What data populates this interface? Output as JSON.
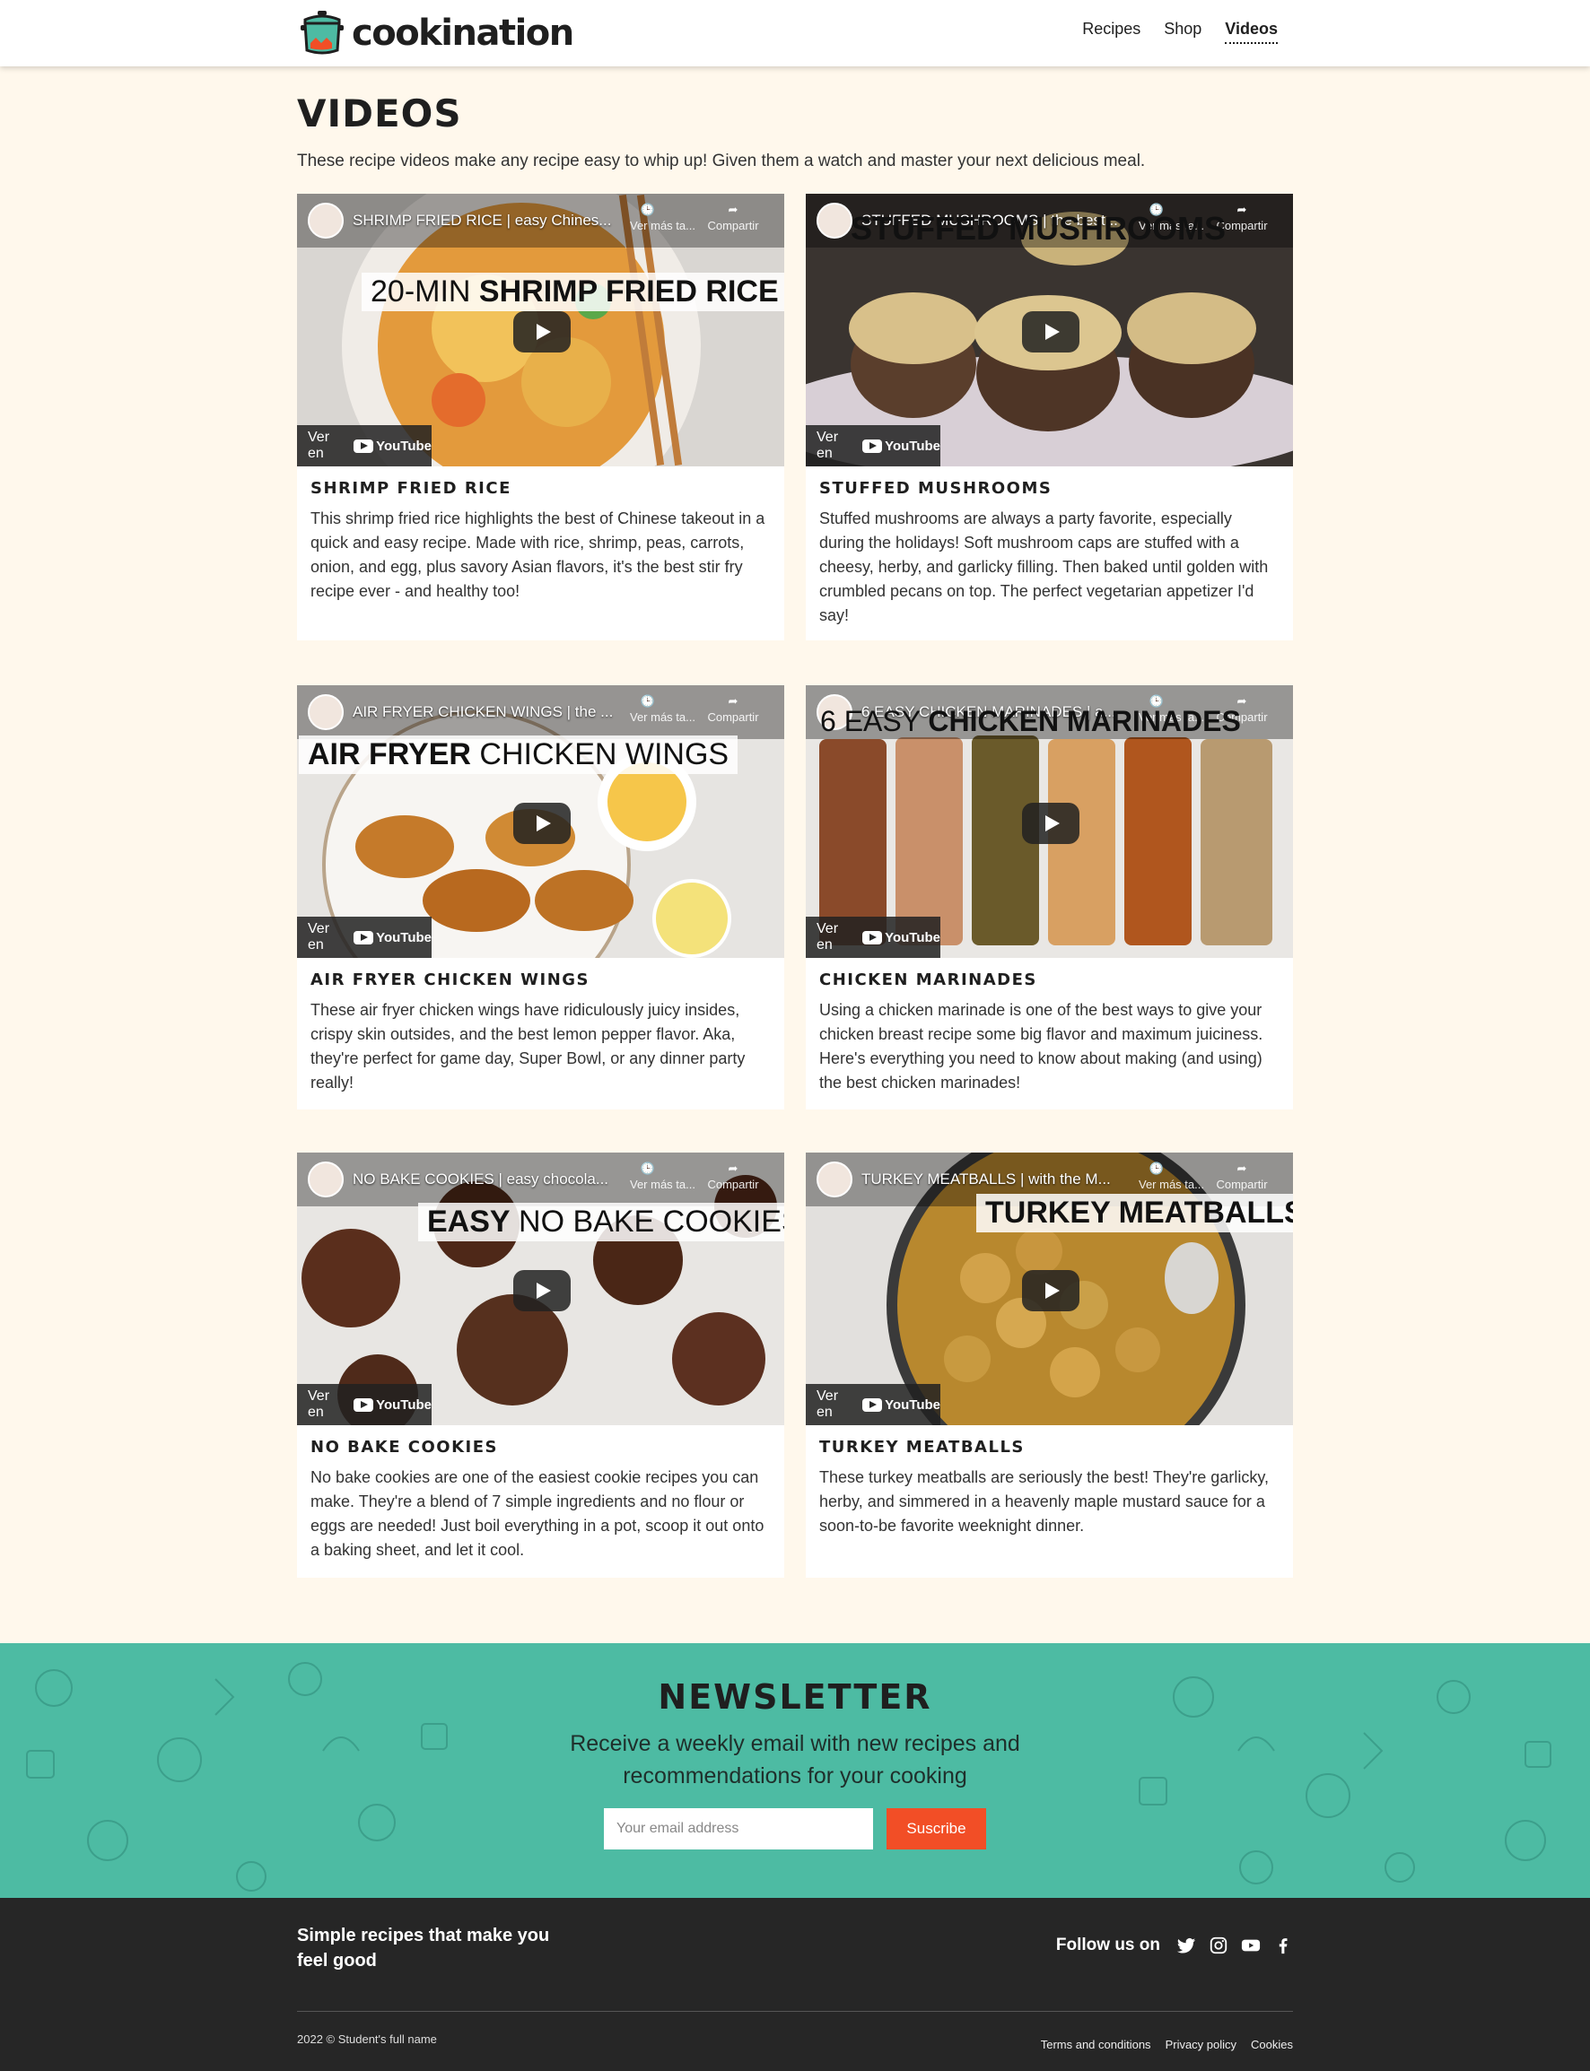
{
  "header": {
    "logo_text": "cookination",
    "nav": [
      {
        "label": "Recipes",
        "active": false
      },
      {
        "label": "Shop",
        "active": false
      },
      {
        "label": "Videos",
        "active": true
      }
    ]
  },
  "main": {
    "title": "VIDEOS",
    "intro": "These recipe videos make any recipe easy to whip up! Given them a watch and master your next delicious meal.",
    "youtube": {
      "watch_later": "Ver más ta...",
      "share": "Compartir",
      "watch_on": "Ver en",
      "youtube_label": "YouTube"
    },
    "cards": [
      {
        "video_title": "SHRIMP FRIED RICE | easy Chines...",
        "banner_light": "20-MIN ",
        "banner_bold": "SHRIMP FRIED RICE",
        "title": "SHRIMP FRIED RICE",
        "text": "This shrimp fried rice highlights the best of Chinese takeout in a quick and easy recipe. Made with rice, shrimp, peas, carrots, onion, and egg, plus savory Asian flavors, it's the best stir fry recipe ever - and healthy too!"
      },
      {
        "video_title": "STUFFED MUSHROOMS | the best...",
        "banner_light": "",
        "banner_bold": "STUFFED MUSHROOMS",
        "title": "STUFFED MUSHROOMS",
        "text": "Stuffed mushrooms are always a party favorite, especially during the holidays! Soft mushroom caps are stuffed with a cheesy, herby, and garlicky filling. Then baked until golden with crumbled pecans on top. The perfect vegetarian appetizer I'd say!"
      },
      {
        "video_title": "AIR FRYER CHICKEN WINGS | the ...",
        "banner_light": " CHICKEN WINGS",
        "banner_bold": "AIR FRYER",
        "title": "AIR FRYER CHICKEN WINGS",
        "text": "These air fryer chicken wings have ridiculously juicy insides, crispy skin outsides, and the best lemon pepper flavor. Aka, they're perfect for game day, Super Bowl, or any dinner party really!"
      },
      {
        "video_title": "6 EASY CHICKEN MARINADES | a...",
        "banner_light": "6 EASY ",
        "banner_bold": "CHICKEN MARINADES",
        "title": "CHICKEN MARINADES",
        "text": "Using a chicken marinade is one of the best ways to give your chicken breast recipe some big flavor and maximum juiciness. Here's everything you need to know about making (and using) the best chicken marinades!"
      },
      {
        "video_title": "NO BAKE COOKIES | easy chocola...",
        "banner_light": " NO BAKE COOKIES",
        "banner_bold": "EASY",
        "title": "NO BAKE COOKIES",
        "text": "No bake cookies are one of the easiest cookie recipes you can make. They're a blend of 7 simple ingredients and no flour or eggs are needed! Just boil everything in a pot, scoop it out onto a baking sheet, and let it cool."
      },
      {
        "video_title": "TURKEY MEATBALLS | with the M...",
        "banner_light": "",
        "banner_bold": "TURKEY MEATBALLS",
        "title": "TURKEY MEATBALLS",
        "text": "These turkey meatballs are seriously the best! They're garlicky, herby, and simmered in a heavenly maple mustard sauce for a soon-to-be favorite weeknight dinner."
      }
    ]
  },
  "newsletter": {
    "title": "NEWSLETTER",
    "text": "Receive a weekly email with new recipes and recommendations for your cooking",
    "placeholder": "Your email address",
    "button": "Suscribe"
  },
  "footer": {
    "tagline": "Simple recipes that make you feel good",
    "follow_label": "Follow us on",
    "social": [
      "twitter-icon",
      "instagram-icon",
      "youtube-icon",
      "facebook-icon"
    ],
    "copyright": "2022 © Student's full name",
    "links": [
      "Terms and conditions",
      "Privacy policy",
      "Cookies"
    ]
  },
  "colors": {
    "background": "#fff8ec",
    "accent": "#4dbba3",
    "button": "#f24e26",
    "footer": "#262626"
  }
}
